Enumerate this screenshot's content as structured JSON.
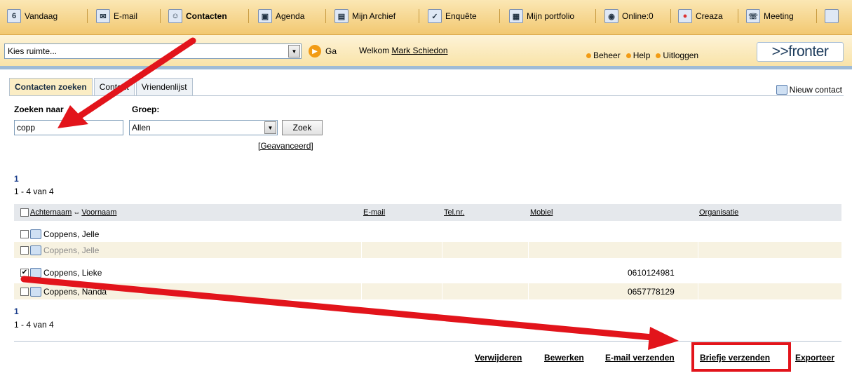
{
  "nav": {
    "items": [
      {
        "label": "Vandaag",
        "icon": "calendar-day-icon",
        "glyph": "6"
      },
      {
        "label": "E-mail",
        "icon": "envelope-icon",
        "glyph": "✉"
      },
      {
        "label": "Contacten",
        "icon": "contacts-icon",
        "glyph": "☺"
      },
      {
        "label": "Agenda",
        "icon": "agenda-icon",
        "glyph": "▣"
      },
      {
        "label": "Mijn Archief",
        "icon": "archive-icon",
        "glyph": "▤"
      },
      {
        "label": "Enquête",
        "icon": "survey-check-icon",
        "glyph": "✓"
      },
      {
        "label": "Mijn portfolio",
        "icon": "portfolio-icon",
        "glyph": "▦"
      },
      {
        "label": "Online:0",
        "icon": "online-users-icon",
        "glyph": "◉"
      },
      {
        "label": "Creaza",
        "icon": "creaza-icon",
        "glyph": "●"
      },
      {
        "label": "Meeting",
        "icon": "meeting-icon",
        "glyph": "☏"
      }
    ]
  },
  "subbar": {
    "space_select": "Kies ruimte...",
    "go_label": "Ga",
    "welcome_prefix": "Welkom",
    "user_name": "Mark Schiedon",
    "links": [
      "Beheer",
      "Help",
      "Uitloggen"
    ],
    "brand": ">>fronter"
  },
  "tabs": [
    "Contacten zoeken",
    "Content",
    "Vriendenlijst"
  ],
  "new_contact": "Nieuw contact",
  "search": {
    "search_label": "Zoeken naar",
    "search_value": "copp",
    "group_label": "Groep:",
    "group_value": "Allen",
    "button": "Zoek",
    "advanced": "[Geavanceerd]"
  },
  "pager": {
    "page": "1",
    "range": "1 - 4 van 4"
  },
  "table": {
    "headers": {
      "lastname": "Achternaam",
      "firstname": "Voornaam",
      "email": "E-mail",
      "phone": "Tel.nr.",
      "mobile": "Mobiel",
      "organisation": "Organisatie"
    },
    "rows": [
      {
        "name": "Coppens, Jelle",
        "mobile": "",
        "checked": false
      },
      {
        "name": "Coppens, Jelle",
        "mobile": "",
        "checked": false
      },
      {
        "name": "Coppens, Lieke",
        "mobile": "0610124981",
        "checked": true
      },
      {
        "name": "Coppens, Nanda",
        "mobile": "0657778129",
        "checked": false
      }
    ]
  },
  "actions": [
    "Verwijderen",
    "Bewerken",
    "E-mail verzenden",
    "Briefje verzenden",
    "Exporteer"
  ],
  "colors": {
    "annotation_red": "#e2141b",
    "accent_orange": "#f29b14",
    "nav_bg": "#f2c871"
  }
}
